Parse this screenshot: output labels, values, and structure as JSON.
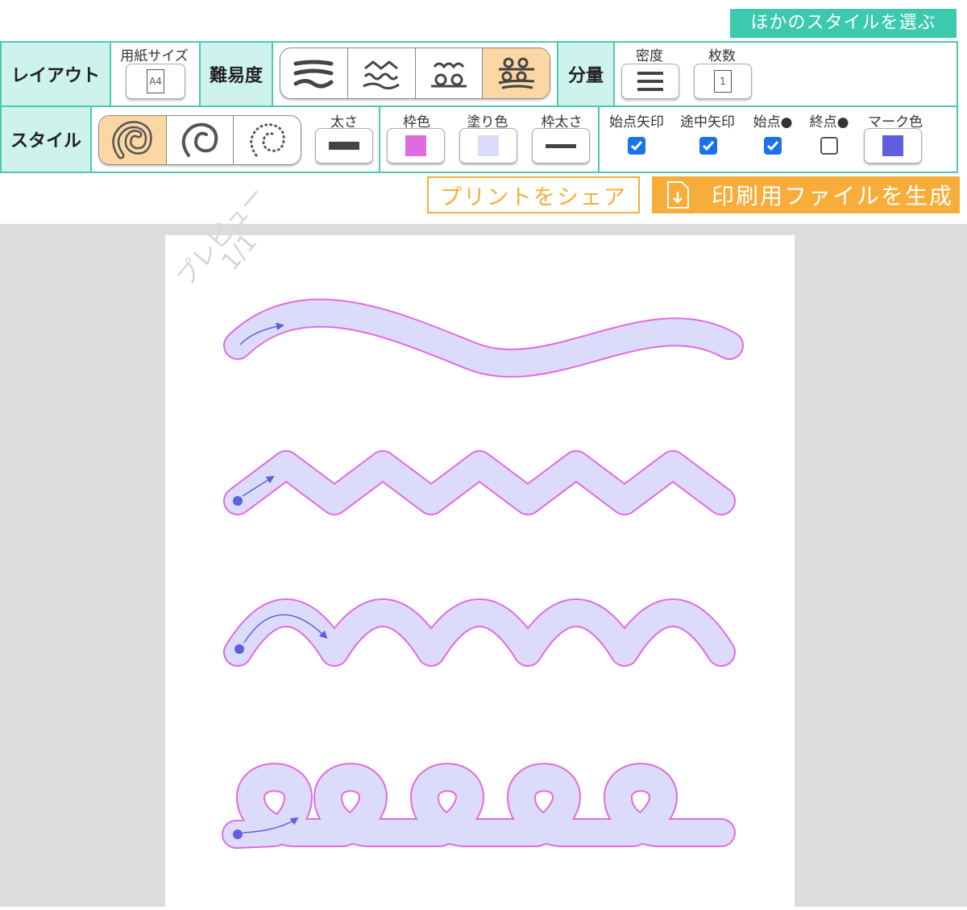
{
  "header": {
    "other_style_label": "ほかのスタイルを選ぶ"
  },
  "layout": {
    "header_label": "レイアウト",
    "paper_size_label": "用紙サイズ",
    "paper_size_value": "A4"
  },
  "difficulty": {
    "header_label": "難易度",
    "options": [
      {
        "name": "gentle-wave-icon",
        "selected": false
      },
      {
        "name": "zigzag-wave-icon",
        "selected": false
      },
      {
        "name": "loop-wave-icon",
        "selected": false
      },
      {
        "name": "double-loop-icon",
        "selected": true
      }
    ]
  },
  "amount": {
    "header_label": "分量",
    "density_label": "密度",
    "sheets_label": "枚数",
    "sheets_value": "1"
  },
  "style": {
    "header_label": "スタイル",
    "line_styles": [
      {
        "name": "filled-outline-style-icon",
        "selected": true
      },
      {
        "name": "single-line-style-icon",
        "selected": false
      },
      {
        "name": "dotted-style-icon",
        "selected": false
      }
    ],
    "thickness_label": "太さ",
    "border_color_label": "枠色",
    "fill_color_label": "塗り色",
    "border_thickness_label": "枠太さ",
    "start_arrow_label": "始点矢印",
    "mid_arrow_label": "途中矢印",
    "start_dot_label": "始点●",
    "end_dot_label": "終点●",
    "mark_color_label": "マーク色",
    "start_arrow": true,
    "mid_arrow": true,
    "start_dot": true,
    "end_dot": false,
    "colors": {
      "border": "#e06be0",
      "fill": "#dcdcfa",
      "mark": "#6060dd",
      "stroke": "#444444"
    }
  },
  "actions": {
    "share_label": "プリントをシェア",
    "generate_label": "印刷用ファイルを生成"
  },
  "preview": {
    "watermark_line1": "プレビュー",
    "watermark_line2": "1/1"
  },
  "theme": {
    "accent_teal": "#3dc9ad",
    "header_bg": "#cdf3ec",
    "selected_bg": "#fbd7a3",
    "orange": "#f8ad3a"
  }
}
